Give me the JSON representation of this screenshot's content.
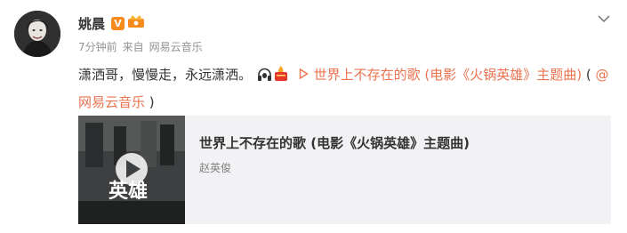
{
  "post": {
    "author": "姚晨",
    "vip_badge": "V",
    "time": "7分钟前",
    "source_prefix": "来自",
    "source_name": "网易云音乐",
    "text_main": "潇洒哥，慢慢走，永远潇洒。",
    "link_song": "世界上不存在的歌 (电影《火锅英雄》主题曲)",
    "link_open": "(",
    "link_source": "@网易云音乐",
    "link_close": ")"
  },
  "card": {
    "title": "世界上不存在的歌 (电影《火锅英雄》主题曲)",
    "artist": "赵英俊",
    "cover_text": "英雄"
  },
  "colors": {
    "link": "#eb7350",
    "vip": "#f78b1e",
    "card_bg": "#f2f2f5"
  },
  "icons": [
    "avatar",
    "vip-icon",
    "crown-icon",
    "chevron-down-icon",
    "headphones-icon",
    "fire-icon",
    "play-icon"
  ]
}
